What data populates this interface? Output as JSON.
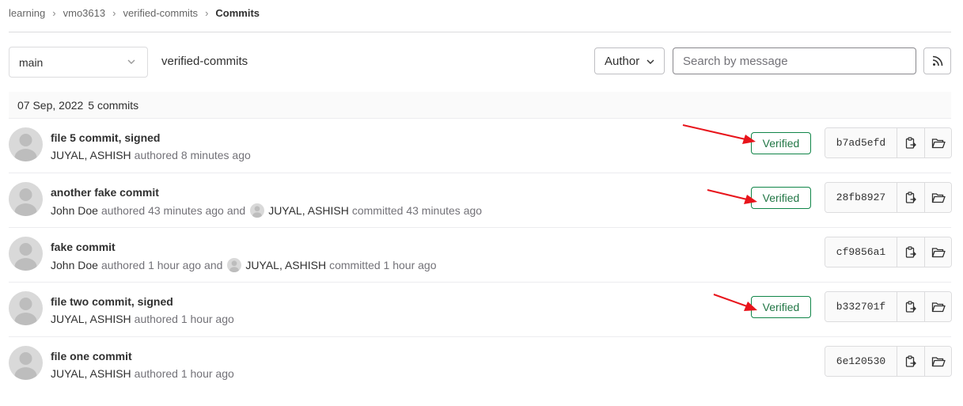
{
  "breadcrumb": [
    "learning",
    "vmo3613",
    "verified-commits",
    "Commits"
  ],
  "toolbar": {
    "branch": "main",
    "project_name": "verified-commits",
    "author_label": "Author",
    "search_placeholder": "Search by message"
  },
  "date_group": {
    "date": "07 Sep, 2022",
    "count": "5 commits"
  },
  "commits": [
    {
      "title": "file 5 commit, signed",
      "author": "JUYAL, ASHISH",
      "authored": "authored 8 minutes ago",
      "verified": "Verified",
      "sha": "b7ad5efd"
    },
    {
      "title": "another fake commit",
      "author": "John Doe",
      "authored": "authored 43 minutes ago",
      "and": "and",
      "committer": "JUYAL, ASHISH",
      "committed": "committed 43 minutes ago",
      "verified": "Verified",
      "sha": "28fb8927"
    },
    {
      "title": "fake commit",
      "author": "John Doe",
      "authored": "authored 1 hour ago",
      "and": "and",
      "committer": "JUYAL, ASHISH",
      "committed": "committed 1 hour ago",
      "sha": "cf9856a1"
    },
    {
      "title": "file two commit, signed",
      "author": "JUYAL, ASHISH",
      "authored": "authored 1 hour ago",
      "verified": "Verified",
      "sha": "b332701f"
    },
    {
      "title": "file one commit",
      "author": "JUYAL, ASHISH",
      "authored": "authored 1 hour ago",
      "sha": "6e120530"
    }
  ],
  "icons": {
    "branch_dropdown": "chevron-down-icon",
    "author_dropdown": "chevron-down-icon",
    "rss": "rss-icon",
    "copy": "copy-to-clipboard-icon",
    "browse": "folder-open-icon",
    "avatar": "default-avatar-icon",
    "annotation": "red-arrow-icon"
  },
  "colors": {
    "verified_border": "#108548",
    "verified_text": "#217645",
    "annotation_arrow": "#e8141b"
  }
}
